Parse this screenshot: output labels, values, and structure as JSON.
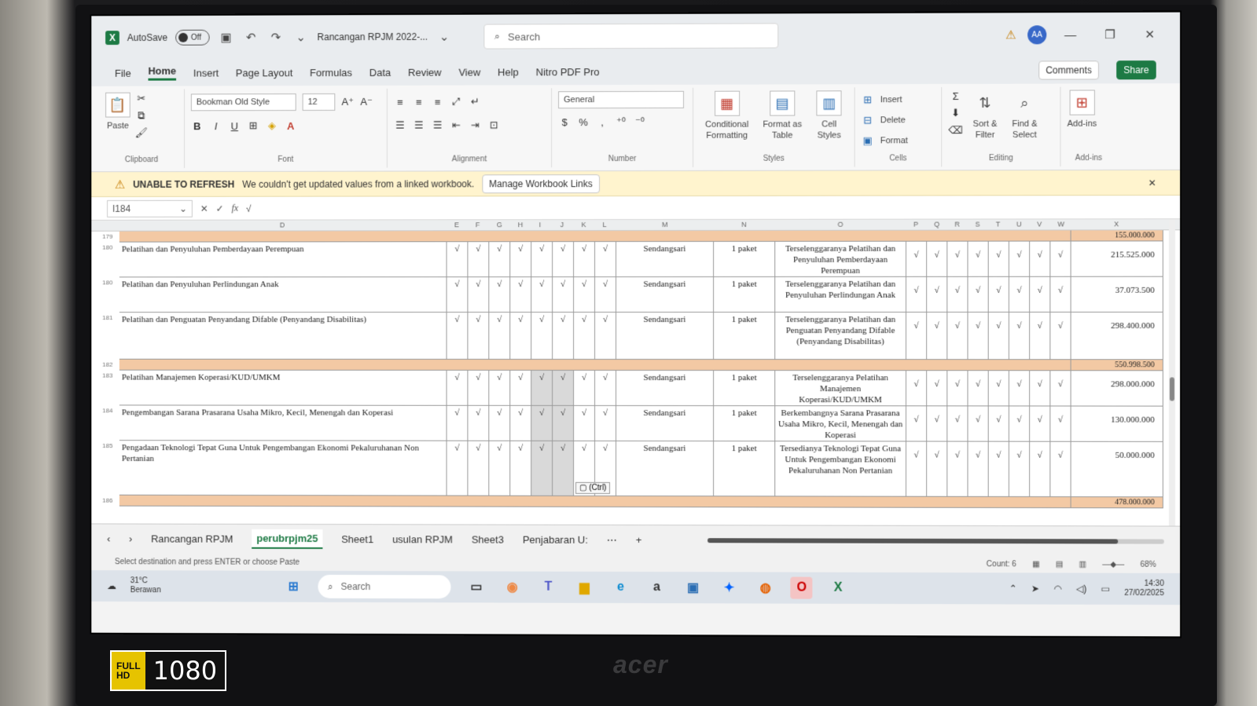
{
  "titlebar": {
    "autosave_label": "AutoSave",
    "autosave_state": "Off",
    "file_name": "Rancangan RPJM 2022-...",
    "search_placeholder": "Search",
    "avatar_initials": "AA"
  },
  "menu": {
    "items": [
      "File",
      "Home",
      "Insert",
      "Page Layout",
      "Formulas",
      "Data",
      "Review",
      "View",
      "Help",
      "Nitro PDF Pro"
    ],
    "active": "Home",
    "comments_label": "Comments",
    "share_label": "Share"
  },
  "ribbon": {
    "clipboard": {
      "paste": "Paste",
      "label": "Clipboard"
    },
    "font": {
      "name": "Bookman Old Style",
      "size": "12",
      "bold": "B",
      "italic": "I",
      "underline": "U",
      "label": "Font"
    },
    "alignment": {
      "label": "Alignment"
    },
    "number": {
      "format": "General",
      "percent": "%",
      "comma": ",",
      "label": "Number"
    },
    "styles": {
      "conditional": "Conditional Formatting",
      "format_table": "Format as Table",
      "cell_styles": "Cell Styles",
      "label": "Styles"
    },
    "cells": {
      "insert": "Insert",
      "delete": "Delete",
      "format": "Format",
      "label": "Cells"
    },
    "editing": {
      "sort": "Sort & Filter",
      "find": "Find & Select",
      "label": "Editing"
    },
    "addins": {
      "addins": "Add-ins",
      "label": "Add-ins"
    }
  },
  "warning": {
    "title": "UNABLE TO REFRESH",
    "message": "We couldn't get updated values from a linked workbook.",
    "button": "Manage Workbook Links"
  },
  "formula_bar": {
    "name_box": "I184",
    "fx": "fx",
    "content": "√"
  },
  "columns": [
    "D",
    "E",
    "F",
    "G",
    "H",
    "I",
    "J",
    "K",
    "L",
    "M",
    "N",
    "O",
    "P",
    "Q",
    "R",
    "S",
    "T",
    "U",
    "V",
    "W",
    "X"
  ],
  "rows": [
    {
      "num": "179",
      "type": "sum",
      "total": "155.000.000"
    },
    {
      "num": "180",
      "type": "item",
      "desc": "Pelatihan dan Penyuluhan Pemberdayaan Perempuan",
      "place": "Sendangsari",
      "vol": "1 paket",
      "outcome": "Terselenggaranya Pelatihan dan Penyuluhan Pemberdayaan Perempuan",
      "total": "215.525.000"
    },
    {
      "num": "180",
      "type": "item",
      "desc": "Pelatihan dan Penyuluhan Perlindungan Anak",
      "place": "Sendangsari",
      "vol": "1 paket",
      "outcome": "Terselenggaranya Pelatihan dan Penyuluhan Perlindungan Anak",
      "total": "37.073.500"
    },
    {
      "num": "181",
      "type": "item",
      "desc": "Pelatihan dan Penguatan Penyandang Difable (Penyandang Disabilitas)",
      "place": "Sendangsari",
      "vol": "1 paket",
      "outcome": "Terselenggaranya Pelatihan dan Penguatan Penyandang Difable (Penyandang Disabilitas)",
      "total": "298.400.000"
    },
    {
      "num": "182",
      "type": "sum",
      "total": "550.998.500"
    },
    {
      "num": "183",
      "type": "item",
      "desc": "Pelatihan Manajemen Koperasi/KUD/UMKM",
      "place": "Sendangsari",
      "vol": "1 paket",
      "outcome": "Terselenggaranya Pelatihan Manajemen Koperasi/KUD/UMKM",
      "total": "298.000.000"
    },
    {
      "num": "184",
      "type": "item",
      "desc": "Pengembangan Sarana Prasarana Usaha Mikro, Kecil, Menengah dan Koperasi",
      "place": "Sendangsari",
      "vol": "1 paket",
      "outcome": "Berkembangnya Sarana Prasarana Usaha Mikro, Kecil, Menengah dan Koperasi",
      "total": "130.000.000"
    },
    {
      "num": "185",
      "type": "item",
      "desc": "Pengadaan Teknologi Tepat Guna Untuk Pengembangan Ekonomi Pekaluruhanan Non Pertanian",
      "place": "Sendangsari",
      "vol": "1 paket",
      "outcome": "Tersedianya Teknologi Tepat Guna Untuk Pengembangan Ekonomi Pekaluruhanan Non Pertanian",
      "total": "50.000.000"
    },
    {
      "num": "186",
      "type": "sum",
      "total": "478.000.000"
    }
  ],
  "check": "√",
  "paste_options": "(Ctrl)",
  "tabs": [
    "Rancangan RPJM",
    "perubrpjm25",
    "Sheet1",
    "usulan RPJM",
    "Sheet3",
    "Penjabaran U:"
  ],
  "active_tab": "perubrpjm25",
  "status": {
    "hint": "Select destination and press ENTER or choose Paste",
    "count": "Count: 6",
    "zoom": "68%"
  },
  "taskbar": {
    "weather_temp": "31°C",
    "weather_desc": "Berawan",
    "search": "Search",
    "time": "14:30",
    "date": "27/02/2025"
  },
  "bezel": {
    "brand": "acer",
    "hd_top": "FULL",
    "hd_bottom": "HD",
    "resolution": "1080"
  }
}
